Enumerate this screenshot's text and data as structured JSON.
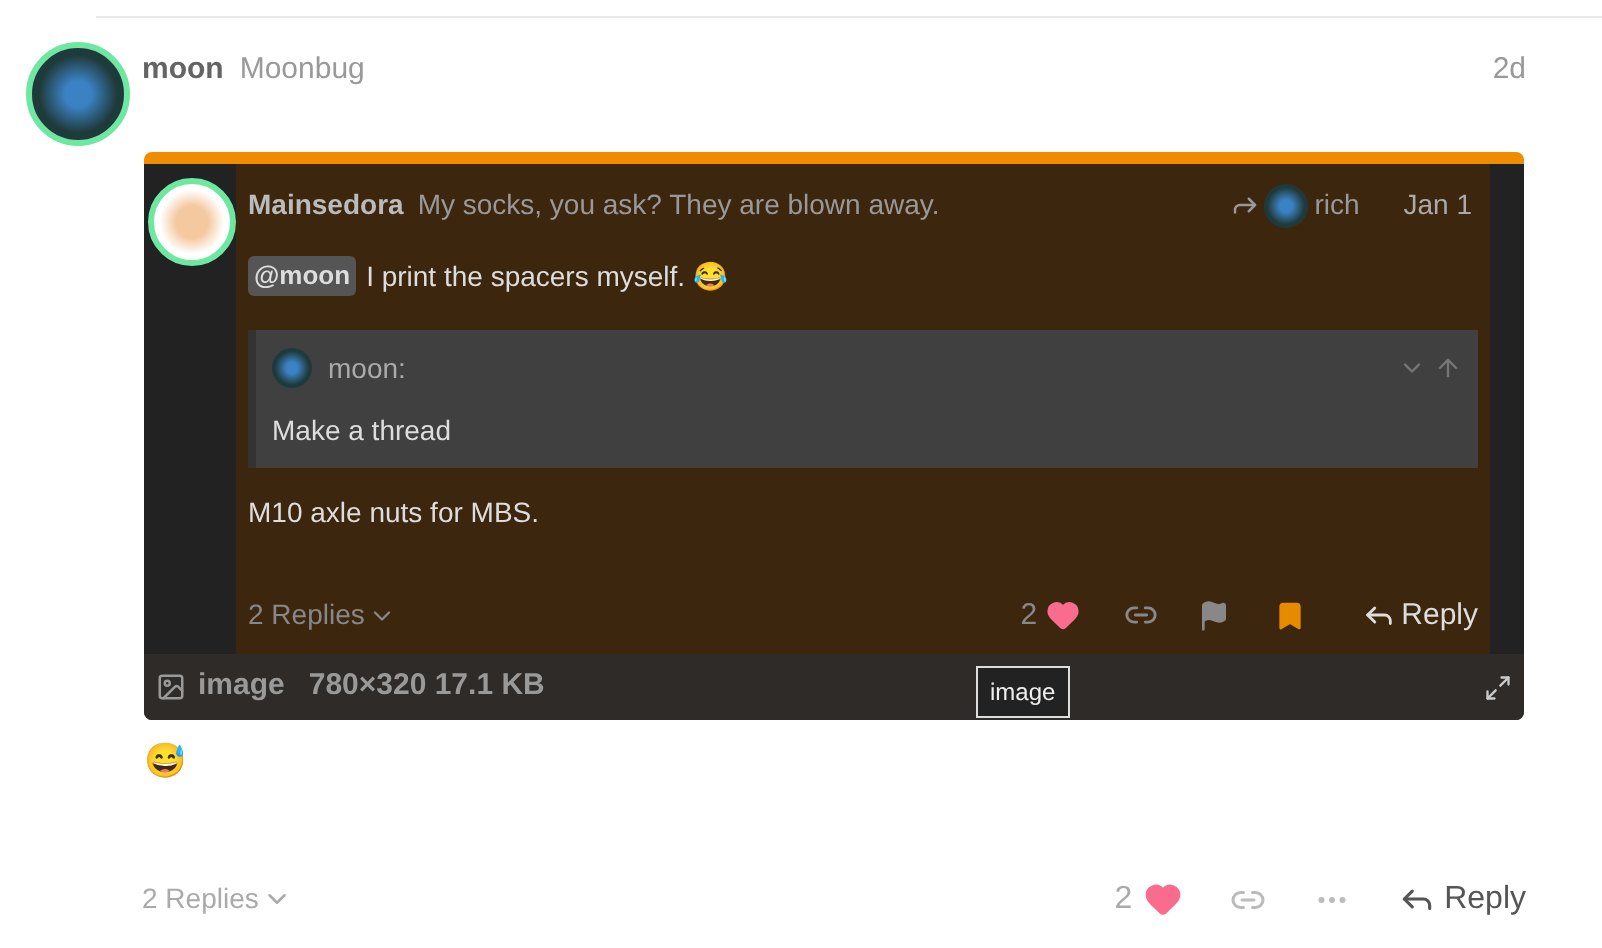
{
  "post": {
    "username": "moon",
    "full_name": "Moonbug",
    "date": "2d",
    "image": {
      "quote_post": {
        "username": "Mainsedora",
        "title": "My socks, you ask? They are blown away.",
        "reply_to": "rich",
        "date": "Jan 1",
        "mention": "@moon",
        "text": "I print the spacers myself.",
        "emoji": "😂",
        "quote": {
          "username": "moon:",
          "text": "Make a thread"
        },
        "body": "M10 axle nuts for MBS.",
        "replies": "2 Replies",
        "likes": "2",
        "liked": true,
        "bookmarked": true,
        "reply_label": "Reply"
      },
      "caption": {
        "name": "image",
        "meta": "780×320 17.1 KB"
      },
      "tooltip": "image"
    },
    "emoji": "😅",
    "replies": "2 Replies",
    "likes": "2",
    "liked": true,
    "reply_label": "Reply"
  }
}
